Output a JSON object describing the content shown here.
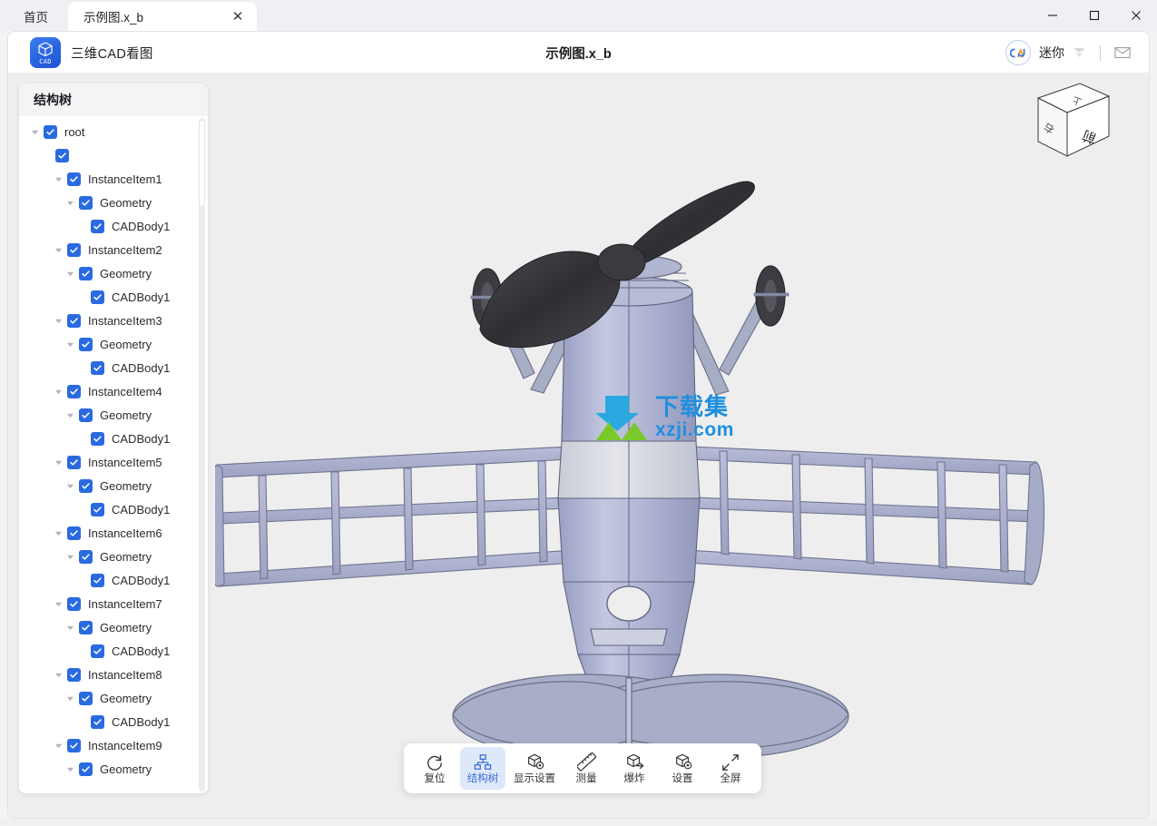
{
  "window": {
    "tabs": [
      {
        "label": "首页",
        "active": false,
        "closable": false
      },
      {
        "label": "示例图.x_b",
        "active": true,
        "closable": true
      }
    ],
    "close_glyph": "✕",
    "controls": {
      "minimize": "minimize-icon",
      "maximize": "maximize-icon",
      "close": "close-icon"
    }
  },
  "header": {
    "app_name": "三维CAD看图",
    "app_icon_text": "CAD",
    "doc_title": "示例图.x_b",
    "user_name": "迷你",
    "avatar_text": "CAD",
    "badge_icon": "diamond-badge-icon",
    "mail_icon": "mail-icon"
  },
  "sidebar": {
    "title": "结构树",
    "nodes": [
      {
        "label": "root",
        "indent": 0,
        "caret": true,
        "checked": true
      },
      {
        "label": "",
        "indent": 1,
        "caret": false,
        "checked": true
      },
      {
        "label": "InstanceItem1",
        "indent": 2,
        "caret": true,
        "checked": true
      },
      {
        "label": "Geometry",
        "indent": 3,
        "caret": true,
        "checked": true
      },
      {
        "label": "CADBody1",
        "indent": 4,
        "caret": false,
        "checked": true
      },
      {
        "label": "InstanceItem2",
        "indent": 2,
        "caret": true,
        "checked": true
      },
      {
        "label": "Geometry",
        "indent": 3,
        "caret": true,
        "checked": true
      },
      {
        "label": "CADBody1",
        "indent": 4,
        "caret": false,
        "checked": true
      },
      {
        "label": "InstanceItem3",
        "indent": 2,
        "caret": true,
        "checked": true
      },
      {
        "label": "Geometry",
        "indent": 3,
        "caret": true,
        "checked": true
      },
      {
        "label": "CADBody1",
        "indent": 4,
        "caret": false,
        "checked": true
      },
      {
        "label": "InstanceItem4",
        "indent": 2,
        "caret": true,
        "checked": true
      },
      {
        "label": "Geometry",
        "indent": 3,
        "caret": true,
        "checked": true
      },
      {
        "label": "CADBody1",
        "indent": 4,
        "caret": false,
        "checked": true
      },
      {
        "label": "InstanceItem5",
        "indent": 2,
        "caret": true,
        "checked": true
      },
      {
        "label": "Geometry",
        "indent": 3,
        "caret": true,
        "checked": true
      },
      {
        "label": "CADBody1",
        "indent": 4,
        "caret": false,
        "checked": true
      },
      {
        "label": "InstanceItem6",
        "indent": 2,
        "caret": true,
        "checked": true
      },
      {
        "label": "Geometry",
        "indent": 3,
        "caret": true,
        "checked": true
      },
      {
        "label": "CADBody1",
        "indent": 4,
        "caret": false,
        "checked": true
      },
      {
        "label": "InstanceItem7",
        "indent": 2,
        "caret": true,
        "checked": true
      },
      {
        "label": "Geometry",
        "indent": 3,
        "caret": true,
        "checked": true
      },
      {
        "label": "CADBody1",
        "indent": 4,
        "caret": false,
        "checked": true
      },
      {
        "label": "InstanceItem8",
        "indent": 2,
        "caret": true,
        "checked": true
      },
      {
        "label": "Geometry",
        "indent": 3,
        "caret": true,
        "checked": true
      },
      {
        "label": "CADBody1",
        "indent": 4,
        "caret": false,
        "checked": true
      },
      {
        "label": "InstanceItem9",
        "indent": 2,
        "caret": true,
        "checked": true
      },
      {
        "label": "Geometry",
        "indent": 3,
        "caret": true,
        "checked": true
      }
    ]
  },
  "viewport": {
    "viewcube": {
      "front_face": "前",
      "side_face": "右",
      "top_face": "上"
    },
    "watermark": {
      "cn": "下载集",
      "url": "xzji.com"
    },
    "model": "aircraft-model"
  },
  "toolbar": {
    "items": [
      {
        "label": "复位",
        "icon": "reset-icon",
        "active": false
      },
      {
        "label": "结构树",
        "icon": "structure-tree-icon",
        "active": true
      },
      {
        "label": "显示设置",
        "icon": "display-settings-icon",
        "active": false
      },
      {
        "label": "测量",
        "icon": "measure-ruler-icon",
        "active": false
      },
      {
        "label": "爆炸",
        "icon": "explode-icon",
        "active": false
      },
      {
        "label": "设置",
        "icon": "settings-icon",
        "active": false
      },
      {
        "label": "全屏",
        "icon": "fullscreen-icon",
        "active": false
      }
    ]
  },
  "colors": {
    "accent": "#2a6ae0",
    "active_bg": "#dfe8fa",
    "active_fg": "#3a6fd6",
    "viewport_bg": "#eeeeee",
    "model_body": "#b4b8d6",
    "model_dark": "#3a3a3e",
    "watermark_blue": "#1e8fe0",
    "watermark_green": "#7ac92b"
  }
}
